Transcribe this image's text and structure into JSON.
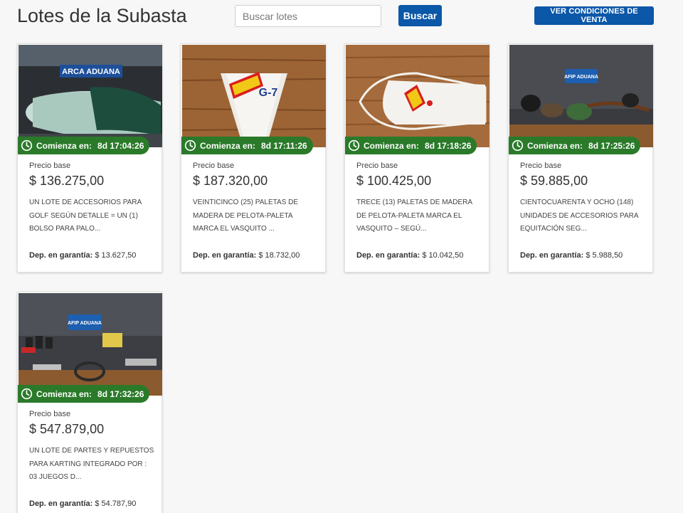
{
  "header": {
    "title": "Lotes de la Subasta",
    "search_placeholder": "Buscar lotes",
    "search_value": "",
    "search_button": "Buscar",
    "conditions_button": "VER CONDICIONES DE VENTA"
  },
  "lots": [
    {
      "countdown_label": "Comienza en:",
      "countdown": "8d 17:04:26",
      "price_label": "Precio base",
      "price": "$ 136.275,00",
      "description": "UN LOTE DE ACCESORIOS PARA GOLF SEGÚN DETALLE = UN (1) BOLSO PARA PALO...",
      "deposit_label": "Dep. en garantía:",
      "deposit": "$ 13.627,50",
      "image_sign": "ARCA ADUANA"
    },
    {
      "countdown_label": "Comienza en:",
      "countdown": "8d 17:11:26",
      "price_label": "Precio base",
      "price": "$ 187.320,00",
      "description": "VEINTICINCO (25) PALETAS DE MADERA DE PELOTA-PALETA MARCA EL VASQUITO ...",
      "deposit_label": "Dep. en garantía:",
      "deposit": "$ 18.732,00",
      "image_sign": "G-7"
    },
    {
      "countdown_label": "Comienza en:",
      "countdown": "8d 17:18:26",
      "price_label": "Precio base",
      "price": "$ 100.425,00",
      "description": "TRECE (13) PALETAS DE MADERA DE PELOTA-PALETA MARCA EL VASQUITO – SEGÚ...",
      "deposit_label": "Dep. en garantía:",
      "deposit": "$ 10.042,50",
      "image_sign": ""
    },
    {
      "countdown_label": "Comienza en:",
      "countdown": "8d 17:25:26",
      "price_label": "Precio base",
      "price": "$ 59.885,00",
      "description": "CIENTOCUARENTA Y OCHO (148) UNIDADES DE ACCESORIOS PARA EQUITACIÓN SEG...",
      "deposit_label": "Dep. en garantía:",
      "deposit": "$ 5.988,50",
      "image_sign": "AFIP ADUANA"
    },
    {
      "countdown_label": "Comienza en:",
      "countdown": "8d 17:32:26",
      "price_label": "Precio base",
      "price": "$ 547.879,00",
      "description": "UN LOTE DE PARTES Y REPUESTOS PARA KARTING INTEGRADO POR : 03 JUEGOS D...",
      "deposit_label": "Dep. en garantía:",
      "deposit": "$ 54.787,90",
      "image_sign": "AFIP ADUANA"
    }
  ],
  "colors": {
    "primary": "#0b57a8",
    "badge": "#2a7a2a",
    "background": "#f7f7f7"
  },
  "icons": {
    "countdown": "clock-icon"
  }
}
